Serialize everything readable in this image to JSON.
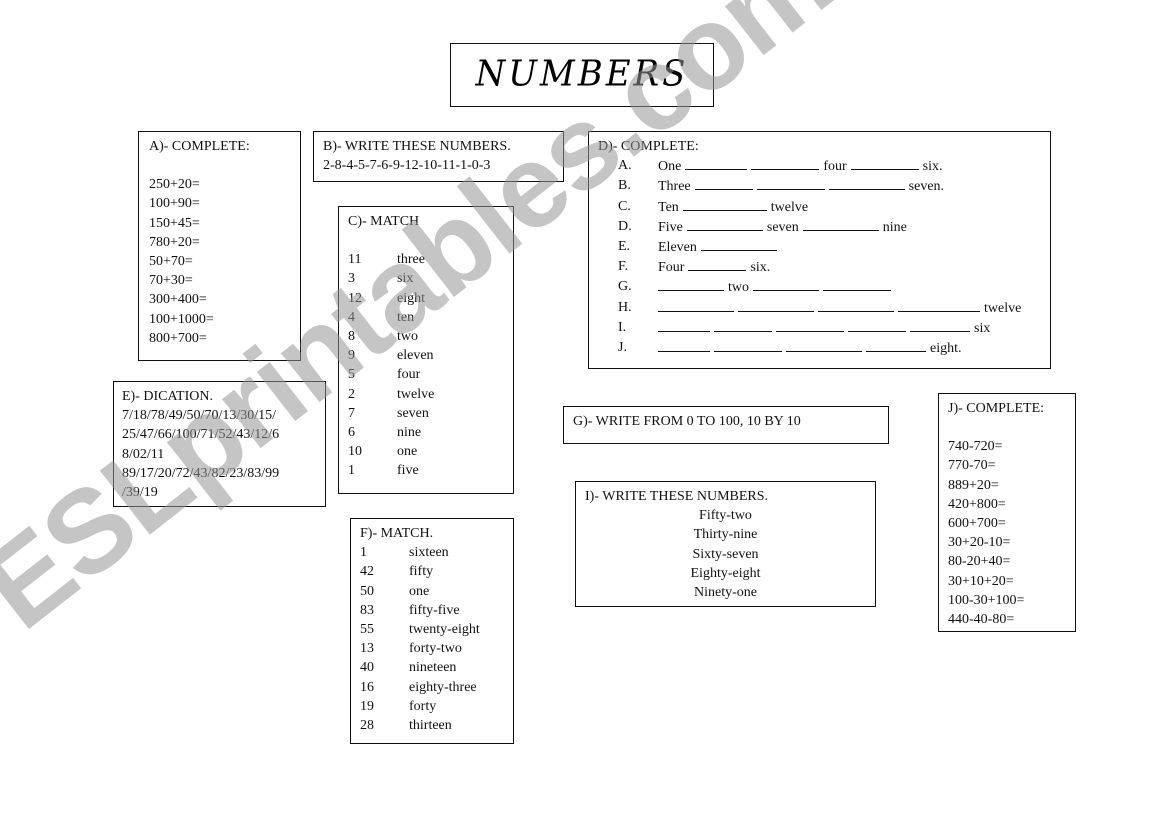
{
  "title": "NUMBERS",
  "watermark": "ESLprintables.com",
  "section_a": {
    "heading": "A)- COMPLETE:",
    "items": [
      "250+20=",
      "100+90=",
      "150+45=",
      "780+20=",
      "50+70=",
      "70+30=",
      "300+400=",
      "100+1000=",
      "800+700="
    ]
  },
  "section_b": {
    "heading": "B)- WRITE THESE NUMBERS.",
    "numbers": "2-8-4-5-7-6-9-12-10-11-1-0-3"
  },
  "section_c": {
    "heading": "C)- MATCH",
    "rows": [
      {
        "num": "11",
        "word": "three"
      },
      {
        "num": "3",
        "word": "six"
      },
      {
        "num": "12",
        "word": "eight"
      },
      {
        "num": "4",
        "word": "ten"
      },
      {
        "num": "8",
        "word": "two"
      },
      {
        "num": "9",
        "word": "eleven"
      },
      {
        "num": "5",
        "word": "four"
      },
      {
        "num": "2",
        "word": "twelve"
      },
      {
        "num": "7",
        "word": "seven"
      },
      {
        "num": "6",
        "word": "nine"
      },
      {
        "num": "10",
        "word": "one"
      },
      {
        "num": "1",
        "word": "five"
      }
    ]
  },
  "section_d": {
    "heading": "D)- COMPLETE:",
    "rows": [
      {
        "letter": "A.",
        "parts": [
          "One",
          "",
          "",
          "four",
          "",
          "six."
        ]
      },
      {
        "letter": "B.",
        "parts": [
          "Three",
          "",
          "",
          "",
          "seven."
        ]
      },
      {
        "letter": "C.",
        "parts": [
          "Ten",
          "",
          "twelve"
        ]
      },
      {
        "letter": "D.",
        "parts": [
          "Five",
          "",
          "seven",
          "",
          "nine"
        ]
      },
      {
        "letter": "E.",
        "parts": [
          "Eleven",
          ""
        ]
      },
      {
        "letter": "F.",
        "parts": [
          "Four",
          "",
          "six."
        ]
      },
      {
        "letter": "G.",
        "parts": [
          "",
          "two",
          "",
          ""
        ]
      },
      {
        "letter": "H.",
        "parts": [
          "",
          "",
          "",
          "",
          "twelve"
        ]
      },
      {
        "letter": "I.",
        "parts": [
          "",
          "",
          "",
          "",
          "",
          "six"
        ]
      },
      {
        "letter": "J.",
        "parts": [
          "",
          "",
          "",
          "",
          "eight."
        ]
      }
    ]
  },
  "section_e": {
    "heading": "E)- DICATION.",
    "lines": [
      "7/18/78/49/50/70/13/30/15/",
      "25/47/66/100/71/52/43/12/6",
      "8/02/11",
      "89/17/20/72/43/82/23/83/99",
      "/39/19"
    ]
  },
  "section_f": {
    "heading": "F)- MATCH.",
    "rows": [
      {
        "num": "1",
        "word": "sixteen"
      },
      {
        "num": "42",
        "word": "fifty"
      },
      {
        "num": "50",
        "word": "one"
      },
      {
        "num": "83",
        "word": "fifty-five"
      },
      {
        "num": "55",
        "word": "twenty-eight"
      },
      {
        "num": "13",
        "word": "forty-two"
      },
      {
        "num": "40",
        "word": "nineteen"
      },
      {
        "num": "16",
        "word": "eighty-three"
      },
      {
        "num": "19",
        "word": "forty"
      },
      {
        "num": "28",
        "word": "thirteen"
      }
    ]
  },
  "section_g": {
    "heading": "G)- WRITE FROM 0 TO 100, 10 BY 10"
  },
  "section_i": {
    "heading": "I)- WRITE THESE NUMBERS.",
    "words": [
      "Fifty-two",
      "Thirty-nine",
      "Sixty-seven",
      "Eighty-eight",
      "Ninety-one"
    ]
  },
  "section_j": {
    "heading": "J)- COMPLETE:",
    "items": [
      "740-720=",
      "770-70=",
      "889+20=",
      "420+800=",
      "600+700=",
      "30+20-10=",
      "80-20+40=",
      "30+10+20=",
      "100-30+100=",
      "440-40-80="
    ]
  }
}
